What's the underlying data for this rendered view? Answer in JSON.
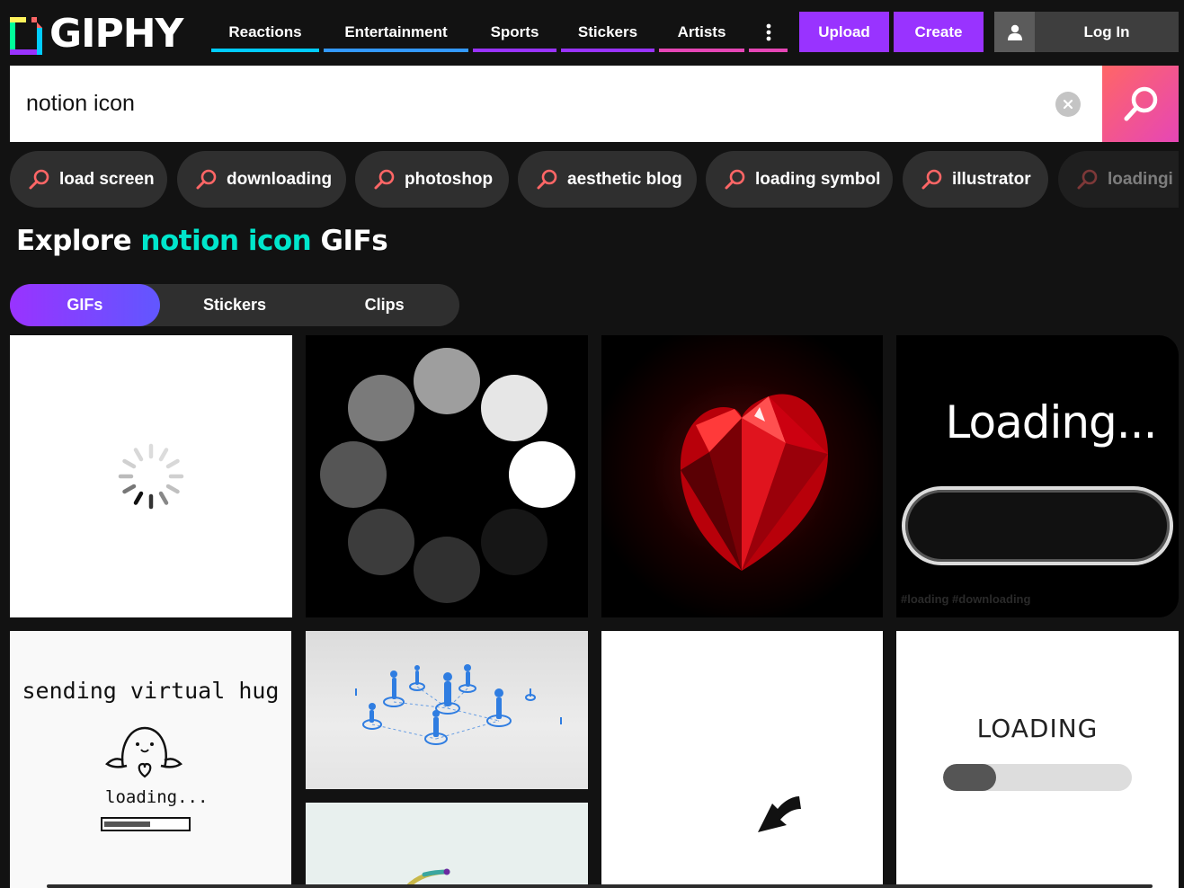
{
  "header": {
    "logo_text": "GIPHY",
    "nav": [
      {
        "label": "Reactions",
        "color": "#00ccff"
      },
      {
        "label": "Entertainment",
        "color": "#3399ff"
      },
      {
        "label": "Sports",
        "color": "#9933ff"
      },
      {
        "label": "Stickers",
        "color": "#9933ff"
      },
      {
        "label": "Artists",
        "color": "#e646b6"
      }
    ],
    "more_icon": "vertical-dots-icon",
    "more_color": "#e646b6",
    "upload_label": "Upload",
    "create_label": "Create",
    "login_label": "Log In",
    "user_icon": "user-icon"
  },
  "search": {
    "value": "notion icon",
    "clear_icon": "clear-icon",
    "search_icon": "search-icon"
  },
  "suggestions": [
    "load screen",
    "downloading",
    "photoshop",
    "aesthetic blog",
    "loading symbol",
    "illustrator",
    "loadingi"
  ],
  "heading": {
    "prefix": "Explore",
    "query": "notion icon",
    "suffix": "GIFs",
    "accent_color": "#00e6cc"
  },
  "tabs": [
    {
      "label": "GIFs",
      "active": true
    },
    {
      "label": "Stickers",
      "active": false
    },
    {
      "label": "Clips",
      "active": false
    }
  ],
  "results": {
    "loading_dots_text": "Loading...",
    "loading_tags": "#loading #downloading",
    "hug_title": "sending virtual hug",
    "hug_loading": "loading...",
    "hug_progress": 0.55,
    "loading_caps": "LOADING",
    "loading_progress": 0.28
  }
}
